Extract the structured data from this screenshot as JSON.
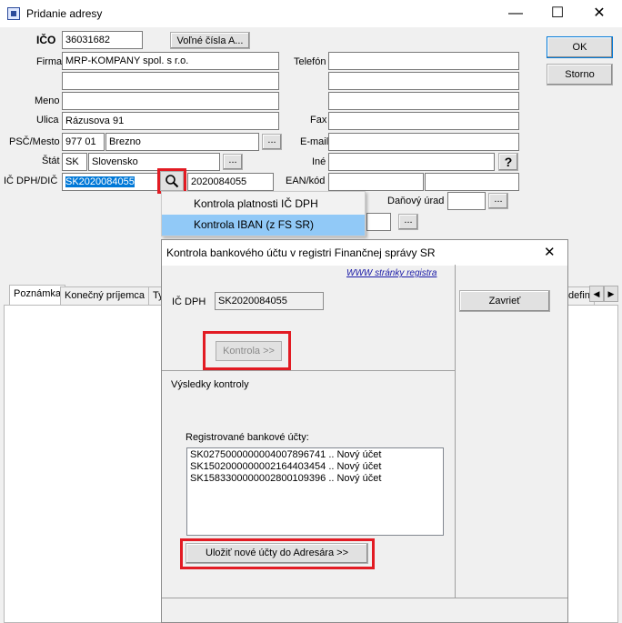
{
  "window": {
    "title": "Pridanie adresy",
    "min": "—",
    "max": "☐",
    "close": "✕"
  },
  "form": {
    "ico_label": "IČO",
    "ico_value": "36031682",
    "free_numbers_btn": "Voľné čísla A...",
    "firma_label": "Firma",
    "firma_value": "MRP-KOMPANY spol. s r.o.",
    "firma_value2": "",
    "meno_label": "Meno",
    "meno_value": "",
    "ulica_label": "Ulica",
    "ulica_value": "Rázusova 91",
    "psc_label": "PSČ/Mesto",
    "psc_value": "977 01",
    "mesto_value": "Brezno",
    "stat_label": "Štát",
    "stat_code": "SK",
    "stat_name": "Slovensko",
    "icdph_label": "IČ DPH/DIČ",
    "icdph_value": "SK2020084055",
    "dic_value": "2020084055",
    "telefon_label": "Telefón",
    "fax_label": "Fax",
    "email_label": "E-mail",
    "ine_label": "Iné",
    "ean_label": "EAN/kód",
    "danovy_urad_label": "Daňový úrad",
    "ok_btn": "OK",
    "storno_btn": "Storno",
    "dots": "...",
    "help": "?"
  },
  "context_menu": {
    "items": [
      "Kontrola platnosti IČ DPH",
      "Kontrola IBAN (z FS SR)"
    ]
  },
  "tabs": [
    "Poznámka",
    "Konečný príjemca",
    "Ty",
    "defin"
  ],
  "dialog": {
    "title": "Kontrola bankového účtu v registri Finančnej správy SR",
    "close": "✕",
    "link": "WWW stránky registra",
    "icdph_label": "IČ DPH",
    "icdph_value": "SK2020084055",
    "kontrola_btn": "Kontrola >>",
    "zavriet_btn": "Zavrieť",
    "results_label": "Výsledky kontroly",
    "accounts_label": "Registrované bankové účty:",
    "accounts": [
      "SK0275000000004007896741 .. Nový účet",
      "SK1502000000002164403454 .. Nový účet",
      "SK1583300000002800109396 .. Nový účet"
    ],
    "save_btn": "Uložiť nové účty do Adresára >>"
  }
}
